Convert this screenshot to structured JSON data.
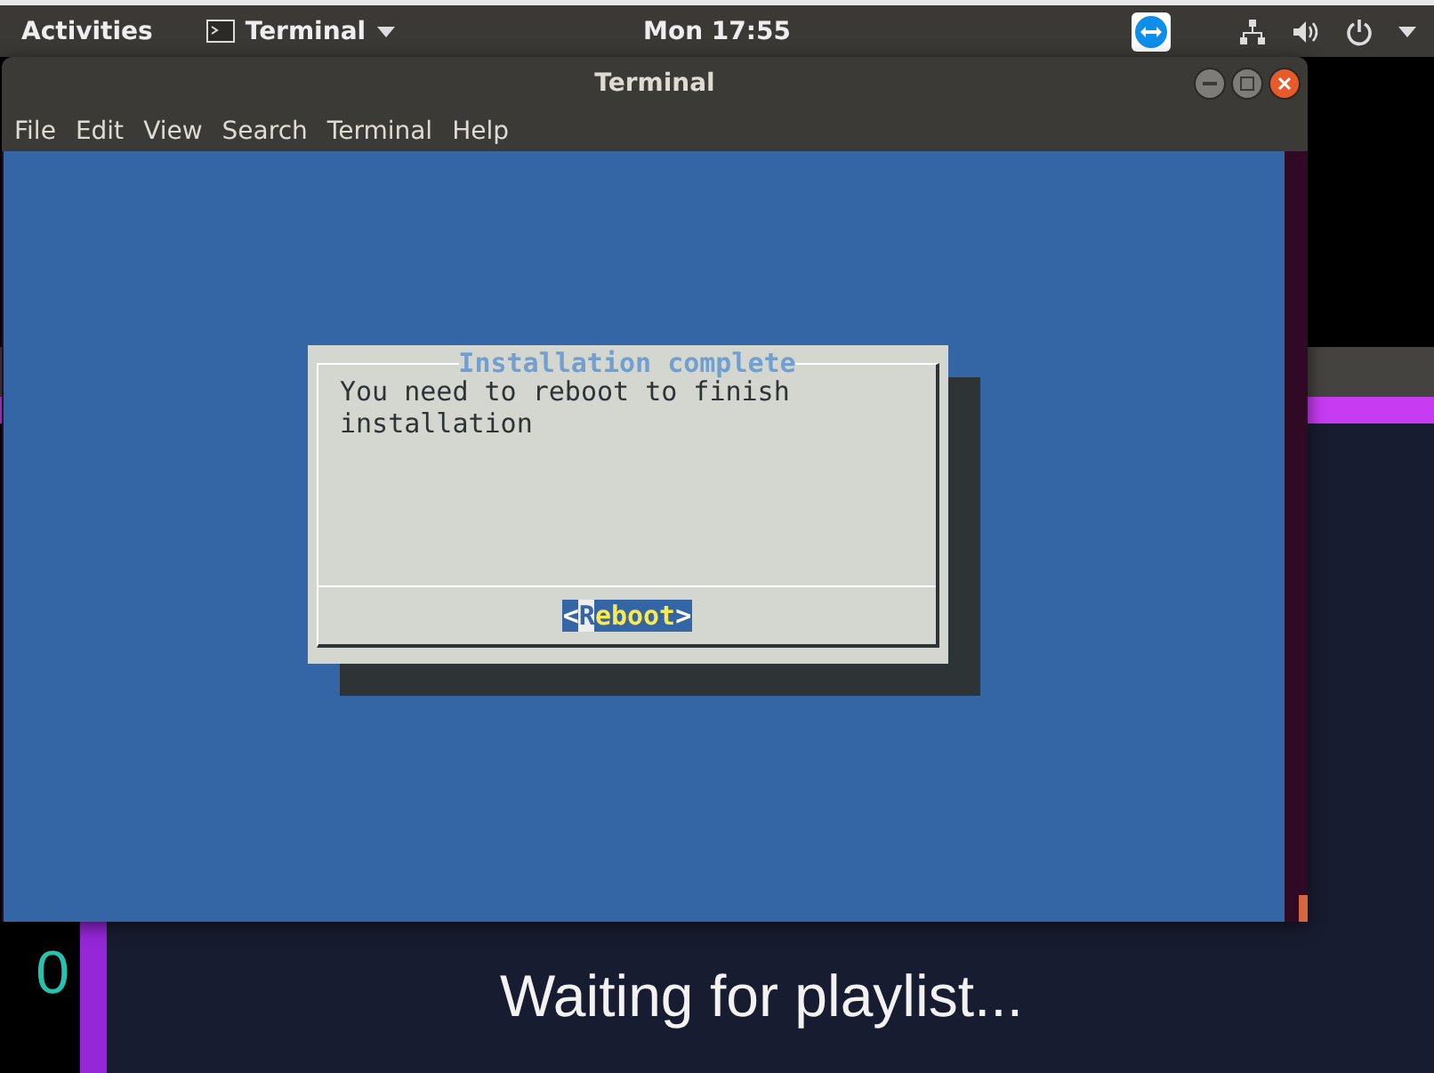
{
  "top_bar": {
    "activities": "Activities",
    "app_menu": "Terminal",
    "clock": "Mon 17:55"
  },
  "background_player": {
    "counter": "0",
    "status": "Waiting for playlist..."
  },
  "window": {
    "title": "Terminal",
    "menu": [
      "File",
      "Edit",
      "View",
      "Search",
      "Terminal",
      "Help"
    ]
  },
  "dialog": {
    "title": "Installation complete",
    "message": "You need to reboot to finish installation",
    "button": {
      "left": "<",
      "hotkey": "R",
      "rest": "eboot",
      "right": ">",
      "selected": true
    }
  }
}
